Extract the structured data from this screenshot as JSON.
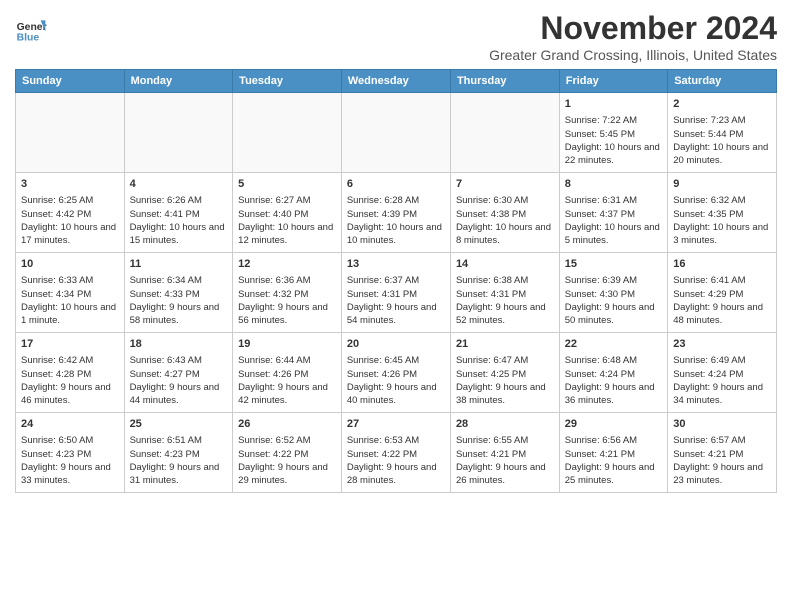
{
  "header": {
    "logo_line1": "General",
    "logo_line2": "Blue",
    "month_title": "November 2024",
    "location": "Greater Grand Crossing, Illinois, United States"
  },
  "days_of_week": [
    "Sunday",
    "Monday",
    "Tuesday",
    "Wednesday",
    "Thursday",
    "Friday",
    "Saturday"
  ],
  "weeks": [
    [
      {
        "day": "",
        "empty": true
      },
      {
        "day": "",
        "empty": true
      },
      {
        "day": "",
        "empty": true
      },
      {
        "day": "",
        "empty": true
      },
      {
        "day": "",
        "empty": true
      },
      {
        "day": "1",
        "sunrise": "7:22 AM",
        "sunset": "5:45 PM",
        "daylight": "10 hours and 22 minutes."
      },
      {
        "day": "2",
        "sunrise": "7:23 AM",
        "sunset": "5:44 PM",
        "daylight": "10 hours and 20 minutes."
      }
    ],
    [
      {
        "day": "3",
        "sunrise": "6:25 AM",
        "sunset": "4:42 PM",
        "daylight": "10 hours and 17 minutes."
      },
      {
        "day": "4",
        "sunrise": "6:26 AM",
        "sunset": "4:41 PM",
        "daylight": "10 hours and 15 minutes."
      },
      {
        "day": "5",
        "sunrise": "6:27 AM",
        "sunset": "4:40 PM",
        "daylight": "10 hours and 12 minutes."
      },
      {
        "day": "6",
        "sunrise": "6:28 AM",
        "sunset": "4:39 PM",
        "daylight": "10 hours and 10 minutes."
      },
      {
        "day": "7",
        "sunrise": "6:30 AM",
        "sunset": "4:38 PM",
        "daylight": "10 hours and 8 minutes."
      },
      {
        "day": "8",
        "sunrise": "6:31 AM",
        "sunset": "4:37 PM",
        "daylight": "10 hours and 5 minutes."
      },
      {
        "day": "9",
        "sunrise": "6:32 AM",
        "sunset": "4:35 PM",
        "daylight": "10 hours and 3 minutes."
      }
    ],
    [
      {
        "day": "10",
        "sunrise": "6:33 AM",
        "sunset": "4:34 PM",
        "daylight": "10 hours and 1 minute."
      },
      {
        "day": "11",
        "sunrise": "6:34 AM",
        "sunset": "4:33 PM",
        "daylight": "9 hours and 58 minutes."
      },
      {
        "day": "12",
        "sunrise": "6:36 AM",
        "sunset": "4:32 PM",
        "daylight": "9 hours and 56 minutes."
      },
      {
        "day": "13",
        "sunrise": "6:37 AM",
        "sunset": "4:31 PM",
        "daylight": "9 hours and 54 minutes."
      },
      {
        "day": "14",
        "sunrise": "6:38 AM",
        "sunset": "4:31 PM",
        "daylight": "9 hours and 52 minutes."
      },
      {
        "day": "15",
        "sunrise": "6:39 AM",
        "sunset": "4:30 PM",
        "daylight": "9 hours and 50 minutes."
      },
      {
        "day": "16",
        "sunrise": "6:41 AM",
        "sunset": "4:29 PM",
        "daylight": "9 hours and 48 minutes."
      }
    ],
    [
      {
        "day": "17",
        "sunrise": "6:42 AM",
        "sunset": "4:28 PM",
        "daylight": "9 hours and 46 minutes."
      },
      {
        "day": "18",
        "sunrise": "6:43 AM",
        "sunset": "4:27 PM",
        "daylight": "9 hours and 44 minutes."
      },
      {
        "day": "19",
        "sunrise": "6:44 AM",
        "sunset": "4:26 PM",
        "daylight": "9 hours and 42 minutes."
      },
      {
        "day": "20",
        "sunrise": "6:45 AM",
        "sunset": "4:26 PM",
        "daylight": "9 hours and 40 minutes."
      },
      {
        "day": "21",
        "sunrise": "6:47 AM",
        "sunset": "4:25 PM",
        "daylight": "9 hours and 38 minutes."
      },
      {
        "day": "22",
        "sunrise": "6:48 AM",
        "sunset": "4:24 PM",
        "daylight": "9 hours and 36 minutes."
      },
      {
        "day": "23",
        "sunrise": "6:49 AM",
        "sunset": "4:24 PM",
        "daylight": "9 hours and 34 minutes."
      }
    ],
    [
      {
        "day": "24",
        "sunrise": "6:50 AM",
        "sunset": "4:23 PM",
        "daylight": "9 hours and 33 minutes."
      },
      {
        "day": "25",
        "sunrise": "6:51 AM",
        "sunset": "4:23 PM",
        "daylight": "9 hours and 31 minutes."
      },
      {
        "day": "26",
        "sunrise": "6:52 AM",
        "sunset": "4:22 PM",
        "daylight": "9 hours and 29 minutes."
      },
      {
        "day": "27",
        "sunrise": "6:53 AM",
        "sunset": "4:22 PM",
        "daylight": "9 hours and 28 minutes."
      },
      {
        "day": "28",
        "sunrise": "6:55 AM",
        "sunset": "4:21 PM",
        "daylight": "9 hours and 26 minutes."
      },
      {
        "day": "29",
        "sunrise": "6:56 AM",
        "sunset": "4:21 PM",
        "daylight": "9 hours and 25 minutes."
      },
      {
        "day": "30",
        "sunrise": "6:57 AM",
        "sunset": "4:21 PM",
        "daylight": "9 hours and 23 minutes."
      }
    ]
  ]
}
